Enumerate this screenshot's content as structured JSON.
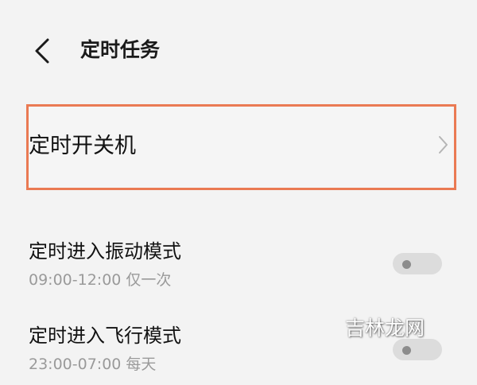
{
  "header": {
    "back_icon": "chevron-left-icon",
    "title": "定时任务"
  },
  "scheduled_power": {
    "label": "定时开关机",
    "chevron_icon": "chevron-right-icon",
    "highlight_color": "#ea7a53"
  },
  "vibrate_mode": {
    "title": "定时进入振动模式",
    "subtitle": "09:00-12:00 仅一次",
    "enabled": false
  },
  "airplane_mode": {
    "title": "定时进入飞行模式",
    "subtitle": "23:00-07:00 每天",
    "enabled": false
  },
  "watermark": {
    "text": "吉林龙网"
  }
}
